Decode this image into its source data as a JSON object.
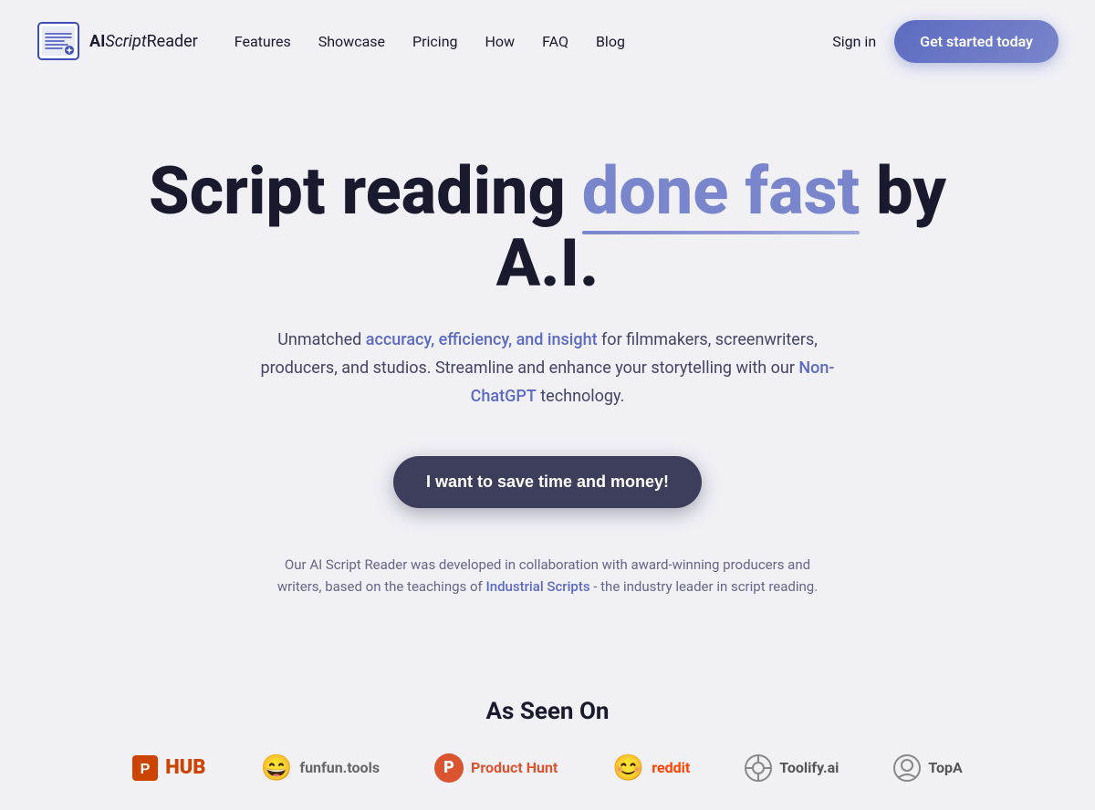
{
  "nav": {
    "logo": {
      "text_ai": "AI",
      "text_script": "Script",
      "text_reader": "Reader"
    },
    "links": [
      {
        "label": "Features",
        "href": "#features"
      },
      {
        "label": "Showcase",
        "href": "#showcase"
      },
      {
        "label": "Pricing",
        "href": "#pricing"
      },
      {
        "label": "How",
        "href": "#how"
      },
      {
        "label": "FAQ",
        "href": "#faq"
      },
      {
        "label": "Blog",
        "href": "#blog"
      }
    ],
    "sign_in": "Sign in",
    "cta": "Get started today"
  },
  "hero": {
    "title_start": "Script reading ",
    "title_highlight": "done fast",
    "title_end": " by A.I.",
    "subtitle_start": "Unmatched ",
    "subtitle_accent": "accuracy, efficiency, and insight",
    "subtitle_mid": " for filmmakers, screenwriters, producers, and studios. Streamline and enhance your storytelling with our ",
    "subtitle_link": "Non-ChatGPT",
    "subtitle_end": " technology.",
    "cta_button": "I want to save time and money!",
    "collab_start": "Our AI Script Reader was developed in collaboration with award-winning producers and writers, based on the teachings of ",
    "collab_link": "Industrial Scripts",
    "collab_end": " - the industry leader in script reading."
  },
  "as_seen_on": {
    "title": "As Seen On",
    "logos": [
      {
        "name": "PHUB",
        "display": "PHUB",
        "type": "phub"
      },
      {
        "name": "funfun.tools",
        "display": "funfun.tools",
        "type": "funfun"
      },
      {
        "name": "Product Hunt",
        "display": "Product Hunt",
        "type": "producthunt"
      },
      {
        "name": "reddit",
        "display": "reddit",
        "type": "reddit"
      },
      {
        "name": "Toolify.ai",
        "display": "Toolify.ai",
        "type": "toolify"
      },
      {
        "name": "TopA",
        "display": "TopA",
        "type": "topa"
      }
    ]
  }
}
